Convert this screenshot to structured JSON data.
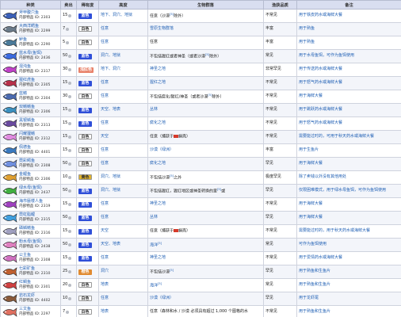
{
  "headers": [
    "种类",
    "卖出",
    "稀有度",
    "高度",
    "生物群落",
    "渔获品质",
    "备注"
  ],
  "rows": [
    {
      "name": "斧甲腹穴鱼",
      "id": "内部物品 ID: 2303",
      "sell": "15",
      "rarity": "蓝色",
      "rc": "#2f4fd8",
      "height": "地下、洞穴、地狱",
      "biome": "任意（沙漠",
      "biome_ref": "[5]",
      "biome2": "除外）",
      "quality": "不常见",
      "note": "用于铁皮药水或海鲜大餐",
      "fc": "#3a5fb8"
    },
    {
      "name": "大西洋鳕鱼",
      "id": "内部物品 ID: 2299",
      "sell": "7",
      "rarity": "白色",
      "rc": "#ffffff",
      "height": "任意",
      "biome": "雪原生物群落",
      "quality": "丰富",
      "note": "用于熟鱼",
      "fc": "#6a7a8a",
      "link": true
    },
    {
      "name": "鲈鱼",
      "id": "内部物品 ID: 2290",
      "sell": "5",
      "rarity": "白色",
      "rc": "#ffffff",
      "height": "任意",
      "biome": "任意",
      "quality": "丰富",
      "note": "用于熟鱼",
      "fc": "#4a7a9a"
    },
    {
      "name": "蓝水母(鱼饵)",
      "id": "内部物品 ID: 2436",
      "sell": "50",
      "rarity": "蓝色",
      "rc": "#2f4fd8",
      "height": "洞穴、地狱",
      "biome": "不包括猩红或者神圣（或者沙漠",
      "biome_ref": "[5]",
      "biome2": "除外）",
      "quality": "常见",
      "note": "用于水母鱼饵，可作为鱼饵使用",
      "fc": "#3a6ae0"
    },
    {
      "name": "混沌鱼",
      "id": "内部物品 ID: 2317",
      "sell": "30",
      "rarity": "浅红色",
      "rc": "#e8826a",
      "height": "地下、洞穴",
      "biome": "神圣之地",
      "quality": "非常罕见",
      "note": "用于传送药水或海鲜大餐",
      "fc": "#c040c8",
      "link": true
    },
    {
      "name": "猩红虎鱼",
      "id": "内部物品 ID: 2305",
      "sell": "15",
      "rarity": "蓝色",
      "rc": "#2f4fd8",
      "height": "任意",
      "biome": "猩红之地",
      "quality": "不常见",
      "note": "用于怒气药水或海鲜大餐",
      "fc": "#b8304a",
      "link": true
    },
    {
      "name": "蓝鳍",
      "id": "内部物品 ID: 2304",
      "sell": "30",
      "rarity": "白色",
      "rc": "#ffffff",
      "height": "任意",
      "biome": "不包括腐化/猩红/神圣（或者沙漠",
      "biome_ref": "[5]",
      "biome2": "除外）",
      "quality": "不常见",
      "note": "用于海鲜大餐",
      "fc": "#4a6ab0"
    },
    {
      "name": "双鳍鳍鱼",
      "id": "内部物品 ID: 2306",
      "sell": "15",
      "rarity": "蓝色",
      "rc": "#2f4fd8",
      "height": "天空、地表",
      "biome": "丛林",
      "quality": "不常见",
      "note": "用于跳跃药水或海鲜大餐",
      "fc": "#3a90c0",
      "link": true
    },
    {
      "name": "黑银鳞鱼",
      "id": "内部物品 ID: 2313",
      "sell": "15",
      "rarity": "蓝色",
      "rc": "#2f4fd8",
      "height": "任意",
      "biome": "腐化之地",
      "quality": "不常见",
      "note": "用于怒气药水或海鲜大餐",
      "fc": "#6a4aa0",
      "link": true
    },
    {
      "name": "闪耀狸鳍",
      "id": "内部物品 ID: 2312",
      "sell": "15",
      "rarity": "白色",
      "rc": "#ffffff",
      "height": "天空",
      "biome": "任意（捕获于",
      "biome2": "蜗壳）",
      "quality": "不常见",
      "note": "需要能过时的，可用于秋天药水或海鲜大餐",
      "fc": "#e08ae0"
    },
    {
      "name": "佩德鱼",
      "id": "内部物品 ID: 4401",
      "sell": "15",
      "rarity": "白色",
      "rc": "#ffffff",
      "height": "任意",
      "biome": "沙漠（绿洲）",
      "quality": "丰富",
      "note": "用于生鱼片",
      "fc": "#3a7ac0",
      "link": true
    },
    {
      "name": "霓彩鳄鱼",
      "id": "内部物品 ID: 2308",
      "sell": "50",
      "rarity": "白色",
      "rc": "#ffffff",
      "height": "任意",
      "biome": "腐化之地",
      "quality": "罕见",
      "note": "用于海鲜大餐",
      "fc": "#7090e0",
      "link": true
    },
    {
      "name": "金鲤鱼",
      "id": "内部物品 ID: 2306",
      "sell": "10",
      "rarity": "黄色",
      "rc": "#e0b22b",
      "height": "洞穴、地狱",
      "biome": "不包括沙漠",
      "biome_ref": "[5]",
      "biome2": "之外",
      "quality": "极度罕见",
      "note": "除了卖钱以外没有其他用处",
      "fc": "#e0a030"
    },
    {
      "name": "绿水母(鱼饵)",
      "id": "内部物品 ID: 2437",
      "sell": "50",
      "rarity": "蓝色",
      "rc": "#2f4fd8",
      "height": "洞穴、地狱",
      "biome": "不包括猩红，猩红地区或神圣转换的里",
      "biome_ref": "[5]",
      "biome2": "或",
      "quality": "罕见",
      "note": "仅限困难模式，用于绿水母鱼饵，可作为鱼饵使用",
      "fc": "#40b040"
    },
    {
      "name": "海市蜃楼人鱼",
      "id": "内部物品 ID: 2319",
      "sell": "15",
      "rarity": "蓝色",
      "rc": "#2f4fd8",
      "height": "任意",
      "biome": "神圣之地",
      "quality": "不常见",
      "note": "用于海鲜大餐",
      "fc": "#a040c0",
      "link": true
    },
    {
      "name": "霓虹脂鲤",
      "id": "内部物品 ID: 2315",
      "sell": "50",
      "rarity": "蓝色",
      "rc": "#2f4fd8",
      "height": "任意",
      "biome": "丛林",
      "quality": "罕见",
      "note": "用于海鲜大餐",
      "fc": "#40a0e0",
      "link": true
    },
    {
      "name": "磷鳞鳍鱼",
      "id": "内部物品 ID: 2316",
      "sell": "15",
      "rarity": "蓝色",
      "rc": "#2f4fd8",
      "height": "天空",
      "biome": "任意（捕获于",
      "biome2": "蜗壳）",
      "quality": "不常见",
      "note": "需要能过时的，用于秋天药水或海鲜大餐",
      "fc": "#a0a0c0"
    },
    {
      "name": "粉水母(鱼饵)",
      "id": "内部物品 ID: 2438",
      "sell": "50",
      "rarity": "蓝色",
      "rc": "#2f4fd8",
      "height": "天空、地表",
      "biome": "海洋",
      "biome_ref": "[5]",
      "quality": "常见",
      "note": "可作为鱼饵使用",
      "fc": "#e080c0",
      "link": true
    },
    {
      "name": "公主鱼",
      "id": "内部物品 ID: 2308",
      "sell": "15",
      "rarity": "蓝色",
      "rc": "#2f4fd8",
      "height": "任意",
      "biome": "神圣之地",
      "quality": "不常见",
      "note": "用于爱情药水或海鲜大餐",
      "fc": "#d070c0",
      "link": true
    },
    {
      "name": "七彩矿鱼",
      "id": "内部物品 ID: 2310",
      "sell": "25",
      "rarity": "橙色",
      "rc": "#e08a30",
      "height": "洞穴",
      "biome": "不包括沙漠",
      "biome_ref": "[5]",
      "quality": "罕见",
      "note": "用于熟鱼和生鱼片",
      "fc": "#c06030"
    },
    {
      "name": "红鲷鱼",
      "id": "内部物品 ID: 2301",
      "sell": "20",
      "rarity": "白色",
      "rc": "#ffffff",
      "height": "地表",
      "biome": "海洋",
      "biome_ref": "[5]",
      "quality": "常见",
      "note": "用于熟鱼和生鱼片",
      "fc": "#d04040",
      "link": true
    },
    {
      "name": "岩石龙虾",
      "id": "内部物品 ID: 4402",
      "sell": "10",
      "rarity": "白色",
      "rc": "#ffffff",
      "height": "任意",
      "biome": "沙漠（绿洲）",
      "quality": "罕见",
      "note": "用于龙虾尾",
      "fc": "#8a5a3a",
      "link": true
    },
    {
      "name": "三文鱼",
      "id": "内部物品 ID: 2297",
      "sell": "7",
      "rarity": "白色",
      "rc": "#ffffff",
      "height": "地表",
      "biome": "任意（森林和水 / 沙漠 必须具有超过 1,000 个图格的水",
      "quality": "不常见",
      "note": "用于熟鱼和生鱼片",
      "fc": "#e07060"
    }
  ]
}
